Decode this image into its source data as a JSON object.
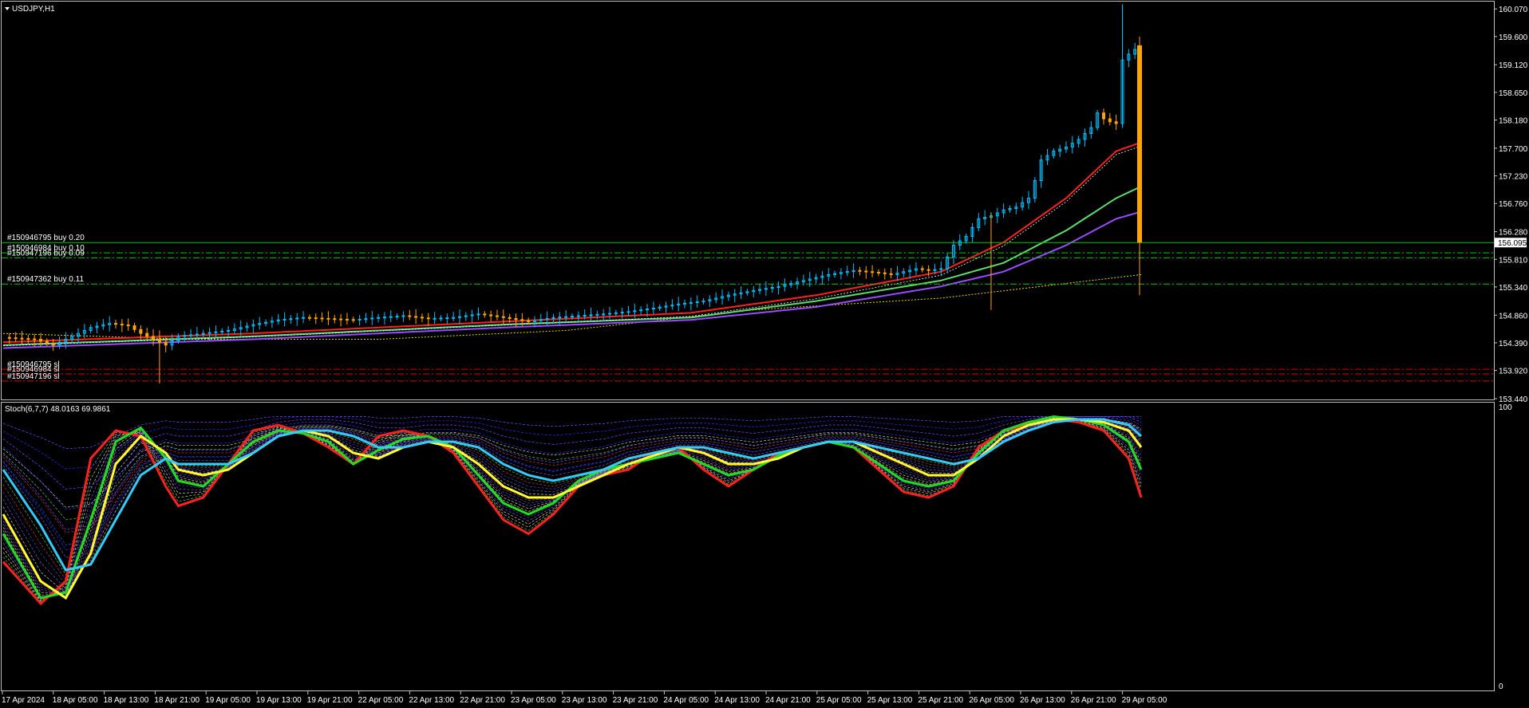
{
  "window": {
    "symbol_title": "USDJPY,H1",
    "menu_icon": "triangle-down-icon"
  },
  "indicator": {
    "label": "Stoch(6,7,7) 48.0163 69.9861",
    "level_top": "100",
    "level_bottom": "0"
  },
  "current_price": "156.095",
  "orders": [
    {
      "label": "#150946795 buy 0.20",
      "price": 156.095,
      "color": "#00c800",
      "style": "solid"
    },
    {
      "label": "#150946984 buy 0.10",
      "price": 155.92,
      "color": "#00c800",
      "style": "dashdot"
    },
    {
      "label": "#150947196 buy 0.09",
      "price": 155.835,
      "color": "#00c800",
      "style": "dashdot"
    },
    {
      "label": "#150947362 buy 0.11",
      "price": 155.39,
      "color": "#00c800",
      "style": "dashdot"
    },
    {
      "label": "#150946795 sl",
      "price": 153.94,
      "color": "#e00000",
      "style": "dashdot"
    },
    {
      "label": "#150946984 sl",
      "price": 153.86,
      "color": "#e00000",
      "style": "dashdot"
    },
    {
      "label": "#150947196 sl",
      "price": 153.74,
      "color": "#e00000",
      "style": "dashdot"
    }
  ],
  "colors": {
    "background": "#000000",
    "grid_frame": "#c0c0c0",
    "bull_candle": "#00bfff",
    "bear_candle": "#ffa500",
    "ma_fast": "#ff2020",
    "ma_mid": "#5ddc6e",
    "ma_slow": "#9a4cff",
    "ma_long": "#e8d800"
  },
  "chart_data": {
    "type": "line",
    "title": "USDJPY,H1",
    "price_ticks": [
      "160.070",
      "159.600",
      "159.120",
      "158.650",
      "158.180",
      "157.700",
      "157.230",
      "156.760",
      "156.280",
      "155.810",
      "155.340",
      "154.860",
      "154.390",
      "153.920",
      "153.440"
    ],
    "ylim": [
      153.44,
      160.14
    ],
    "time_ticks": [
      "17 Apr 2024",
      "18 Apr 05:00",
      "18 Apr 13:00",
      "18 Apr 21:00",
      "19 Apr 05:00",
      "19 Apr 13:00",
      "19 Apr 21:00",
      "22 Apr 05:00",
      "22 Apr 13:00",
      "22 Apr 21:00",
      "23 Apr 05:00",
      "23 Apr 13:00",
      "23 Apr 21:00",
      "24 Apr 05:00",
      "24 Apr 13:00",
      "24 Apr 21:00",
      "25 Apr 05:00",
      "25 Apr 13:00",
      "25 Apr 21:00",
      "26 Apr 05:00",
      "26 Apr 13:00",
      "26 Apr 21:00",
      "29 Apr 05:00"
    ],
    "price_path": [
      [
        0,
        154.48
      ],
      [
        5,
        154.45
      ],
      [
        8,
        154.35
      ],
      [
        12,
        154.55
      ],
      [
        14,
        154.65
      ],
      [
        17,
        154.72
      ],
      [
        20,
        154.68
      ],
      [
        22,
        154.55
      ],
      [
        24,
        154.45
      ],
      [
        26,
        154.35
      ],
      [
        28,
        154.5
      ],
      [
        32,
        154.55
      ],
      [
        36,
        154.6
      ],
      [
        40,
        154.7
      ],
      [
        44,
        154.78
      ],
      [
        48,
        154.82
      ],
      [
        52,
        154.8
      ],
      [
        56,
        154.78
      ],
      [
        60,
        154.82
      ],
      [
        64,
        154.85
      ],
      [
        68,
        154.8
      ],
      [
        72,
        154.82
      ],
      [
        76,
        154.88
      ],
      [
        80,
        154.82
      ],
      [
        84,
        154.75
      ],
      [
        88,
        154.82
      ],
      [
        92,
        154.85
      ],
      [
        96,
        154.88
      ],
      [
        100,
        154.92
      ],
      [
        104,
        154.98
      ],
      [
        108,
        155.05
      ],
      [
        112,
        155.1
      ],
      [
        116,
        155.2
      ],
      [
        120,
        155.28
      ],
      [
        124,
        155.35
      ],
      [
        128,
        155.45
      ],
      [
        132,
        155.55
      ],
      [
        136,
        155.62
      ],
      [
        138,
        155.6
      ],
      [
        140,
        155.58
      ],
      [
        142,
        155.55
      ],
      [
        144,
        155.6
      ],
      [
        146,
        155.65
      ],
      [
        148,
        155.62
      ],
      [
        150,
        155.65
      ],
      [
        151,
        155.85
      ],
      [
        152,
        156.05
      ],
      [
        154,
        156.2
      ],
      [
        156,
        156.5
      ],
      [
        158,
        156.55
      ],
      [
        160,
        156.65
      ],
      [
        162,
        156.7
      ],
      [
        164,
        156.85
      ],
      [
        165,
        157.15
      ],
      [
        166,
        157.5
      ],
      [
        168,
        157.65
      ],
      [
        170,
        157.72
      ],
      [
        172,
        157.85
      ],
      [
        174,
        158.05
      ],
      [
        175,
        158.3
      ],
      [
        176,
        158.2
      ],
      [
        177,
        158.15
      ],
      [
        178,
        158.12
      ],
      [
        179,
        159.2
      ],
      [
        180,
        159.3
      ],
      [
        181,
        159.38
      ],
      [
        182,
        159.42
      ]
    ],
    "last_bar": {
      "open": 159.45,
      "high": 159.6,
      "low": 155.2,
      "close": 156.095
    },
    "ma_fast": [
      [
        0,
        154.4
      ],
      [
        40,
        154.55
      ],
      [
        80,
        154.75
      ],
      [
        110,
        154.9
      ],
      [
        130,
        155.2
      ],
      [
        150,
        155.6
      ],
      [
        160,
        156.1
      ],
      [
        170,
        156.85
      ],
      [
        178,
        157.65
      ],
      [
        182,
        157.8
      ]
    ],
    "ma_mid": [
      [
        0,
        154.35
      ],
      [
        40,
        154.5
      ],
      [
        80,
        154.7
      ],
      [
        110,
        154.82
      ],
      [
        130,
        155.1
      ],
      [
        150,
        155.45
      ],
      [
        160,
        155.75
      ],
      [
        170,
        156.3
      ],
      [
        178,
        156.85
      ],
      [
        182,
        157.05
      ]
    ],
    "ma_slow": [
      [
        0,
        154.3
      ],
      [
        40,
        154.45
      ],
      [
        80,
        154.65
      ],
      [
        110,
        154.78
      ],
      [
        130,
        155.0
      ],
      [
        150,
        155.35
      ],
      [
        160,
        155.6
      ],
      [
        170,
        156.05
      ],
      [
        178,
        156.5
      ],
      [
        182,
        156.62
      ]
    ],
    "ma_long": [
      [
        0,
        154.55
      ],
      [
        30,
        154.45
      ],
      [
        60,
        154.45
      ],
      [
        90,
        154.6
      ],
      [
        120,
        154.95
      ],
      [
        150,
        155.15
      ],
      [
        170,
        155.4
      ],
      [
        182,
        155.55
      ]
    ],
    "stoch_ylim": [
      0,
      100
    ],
    "stoch_lines": [
      {
        "color": "#ff2020",
        "points": [
          [
            0,
            45
          ],
          [
            6,
            30
          ],
          [
            10,
            38
          ],
          [
            14,
            82
          ],
          [
            18,
            92
          ],
          [
            22,
            90
          ],
          [
            26,
            72
          ],
          [
            28,
            65
          ],
          [
            32,
            68
          ],
          [
            36,
            80
          ],
          [
            40,
            92
          ],
          [
            44,
            94
          ],
          [
            48,
            91
          ],
          [
            52,
            86
          ],
          [
            56,
            80
          ],
          [
            60,
            90
          ],
          [
            64,
            92
          ],
          [
            68,
            90
          ],
          [
            72,
            84
          ],
          [
            76,
            72
          ],
          [
            80,
            60
          ],
          [
            84,
            55
          ],
          [
            88,
            62
          ],
          [
            92,
            72
          ],
          [
            96,
            76
          ],
          [
            100,
            78
          ],
          [
            104,
            84
          ],
          [
            108,
            86
          ],
          [
            112,
            78
          ],
          [
            116,
            72
          ],
          [
            120,
            78
          ],
          [
            124,
            84
          ],
          [
            128,
            86
          ],
          [
            132,
            88
          ],
          [
            136,
            86
          ],
          [
            140,
            78
          ],
          [
            144,
            70
          ],
          [
            148,
            68
          ],
          [
            152,
            72
          ],
          [
            156,
            86
          ],
          [
            160,
            92
          ],
          [
            164,
            94
          ],
          [
            168,
            96
          ],
          [
            172,
            95
          ],
          [
            176,
            92
          ],
          [
            180,
            82
          ],
          [
            182,
            68
          ]
        ]
      },
      {
        "color": "#22dd22",
        "points": [
          [
            0,
            55
          ],
          [
            6,
            32
          ],
          [
            10,
            34
          ],
          [
            14,
            60
          ],
          [
            18,
            88
          ],
          [
            22,
            93
          ],
          [
            26,
            82
          ],
          [
            28,
            74
          ],
          [
            32,
            72
          ],
          [
            36,
            80
          ],
          [
            40,
            88
          ],
          [
            44,
            92
          ],
          [
            48,
            91
          ],
          [
            52,
            88
          ],
          [
            56,
            80
          ],
          [
            60,
            85
          ],
          [
            64,
            89
          ],
          [
            68,
            90
          ],
          [
            72,
            86
          ],
          [
            76,
            76
          ],
          [
            80,
            66
          ],
          [
            84,
            62
          ],
          [
            88,
            66
          ],
          [
            92,
            74
          ],
          [
            96,
            78
          ],
          [
            100,
            80
          ],
          [
            104,
            82
          ],
          [
            108,
            84
          ],
          [
            112,
            80
          ],
          [
            116,
            76
          ],
          [
            120,
            78
          ],
          [
            124,
            83
          ],
          [
            128,
            86
          ],
          [
            132,
            88
          ],
          [
            136,
            86
          ],
          [
            140,
            80
          ],
          [
            144,
            74
          ],
          [
            148,
            72
          ],
          [
            152,
            74
          ],
          [
            156,
            84
          ],
          [
            160,
            92
          ],
          [
            164,
            95
          ],
          [
            168,
            97
          ],
          [
            172,
            96
          ],
          [
            176,
            94
          ],
          [
            180,
            88
          ],
          [
            182,
            78
          ]
        ]
      },
      {
        "color": "#ffff33",
        "points": [
          [
            0,
            62
          ],
          [
            6,
            38
          ],
          [
            10,
            32
          ],
          [
            14,
            48
          ],
          [
            18,
            80
          ],
          [
            22,
            90
          ],
          [
            26,
            84
          ],
          [
            28,
            78
          ],
          [
            32,
            76
          ],
          [
            36,
            78
          ],
          [
            40,
            84
          ],
          [
            44,
            90
          ],
          [
            48,
            92
          ],
          [
            52,
            90
          ],
          [
            56,
            84
          ],
          [
            60,
            82
          ],
          [
            64,
            86
          ],
          [
            68,
            88
          ],
          [
            72,
            86
          ],
          [
            76,
            80
          ],
          [
            80,
            72
          ],
          [
            84,
            68
          ],
          [
            88,
            68
          ],
          [
            92,
            72
          ],
          [
            96,
            76
          ],
          [
            100,
            80
          ],
          [
            104,
            83
          ],
          [
            108,
            86
          ],
          [
            112,
            84
          ],
          [
            116,
            80
          ],
          [
            120,
            80
          ],
          [
            124,
            82
          ],
          [
            128,
            86
          ],
          [
            132,
            88
          ],
          [
            136,
            88
          ],
          [
            140,
            84
          ],
          [
            144,
            80
          ],
          [
            148,
            76
          ],
          [
            152,
            76
          ],
          [
            156,
            82
          ],
          [
            160,
            90
          ],
          [
            164,
            94
          ],
          [
            168,
            96
          ],
          [
            172,
            96
          ],
          [
            176,
            95
          ],
          [
            180,
            92
          ],
          [
            182,
            86
          ]
        ]
      },
      {
        "color": "#33ccff",
        "points": [
          [
            0,
            78
          ],
          [
            6,
            58
          ],
          [
            10,
            42
          ],
          [
            14,
            44
          ],
          [
            18,
            60
          ],
          [
            22,
            76
          ],
          [
            26,
            82
          ],
          [
            28,
            80
          ],
          [
            32,
            80
          ],
          [
            36,
            80
          ],
          [
            40,
            84
          ],
          [
            44,
            90
          ],
          [
            48,
            92
          ],
          [
            52,
            92
          ],
          [
            56,
            90
          ],
          [
            60,
            86
          ],
          [
            64,
            86
          ],
          [
            68,
            88
          ],
          [
            72,
            88
          ],
          [
            76,
            86
          ],
          [
            80,
            80
          ],
          [
            84,
            76
          ],
          [
            88,
            74
          ],
          [
            92,
            76
          ],
          [
            96,
            78
          ],
          [
            100,
            82
          ],
          [
            104,
            84
          ],
          [
            108,
            86
          ],
          [
            112,
            86
          ],
          [
            116,
            84
          ],
          [
            120,
            82
          ],
          [
            124,
            84
          ],
          [
            128,
            86
          ],
          [
            132,
            88
          ],
          [
            136,
            88
          ],
          [
            140,
            86
          ],
          [
            144,
            84
          ],
          [
            148,
            82
          ],
          [
            152,
            80
          ],
          [
            156,
            82
          ],
          [
            160,
            88
          ],
          [
            164,
            92
          ],
          [
            168,
            95
          ],
          [
            172,
            96
          ],
          [
            176,
            96
          ],
          [
            180,
            94
          ],
          [
            182,
            90
          ]
        ]
      }
    ]
  }
}
